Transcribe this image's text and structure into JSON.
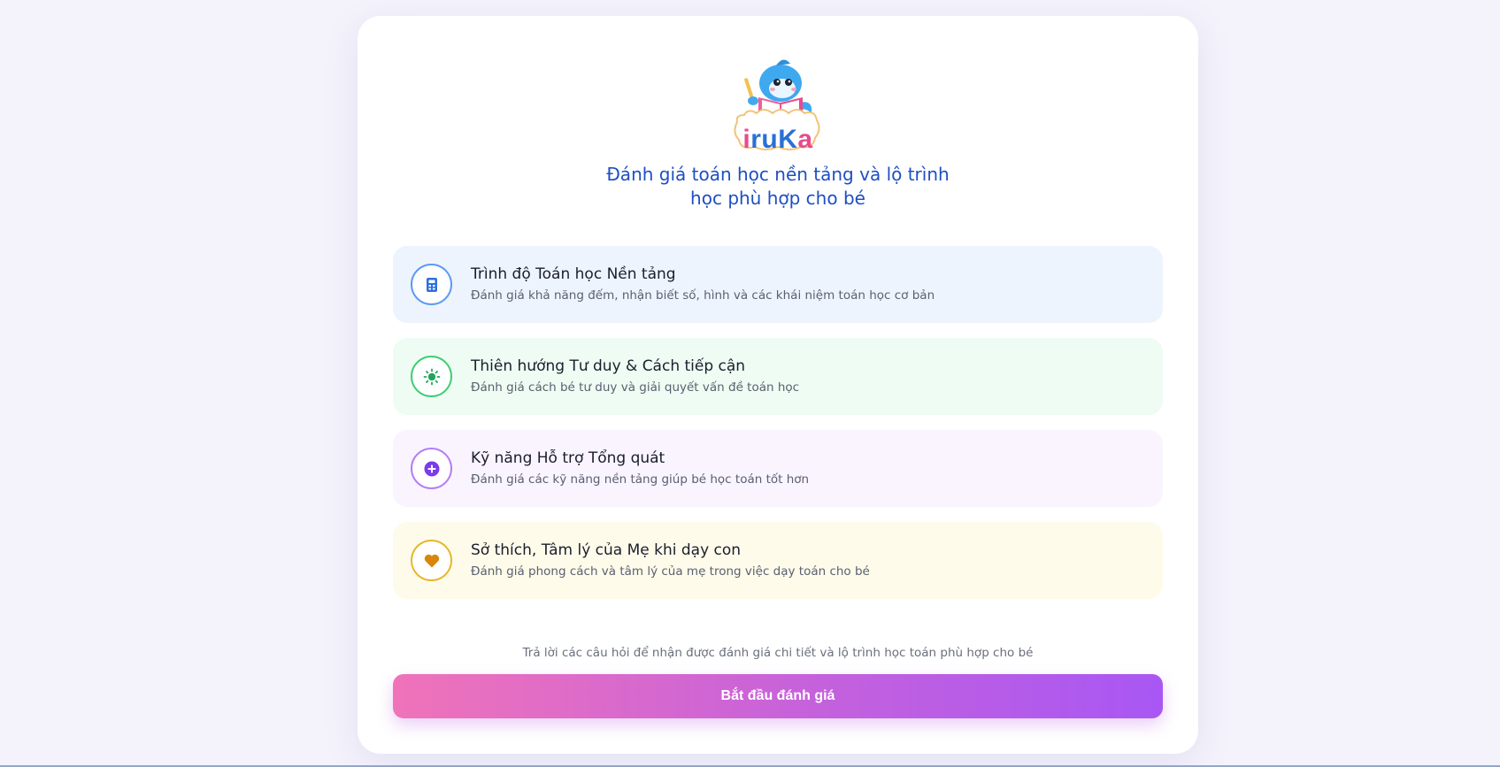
{
  "logo": {
    "text": "iruKa",
    "mascot": "dolphin-reading-book"
  },
  "headline": {
    "line1": "Đánh giá toán học nền tảng và lộ trình",
    "line2": "học phù hợp cho bé"
  },
  "features": [
    {
      "icon": "calculator-icon",
      "color": "#2f6fe0",
      "title": "Trình độ Toán học Nền tảng",
      "description": "Đánh giá khả năng đếm, nhận biết số, hình và các khái niệm toán học cơ bản"
    },
    {
      "icon": "sun-icon",
      "color": "#22a55b",
      "title": "Thiên hướng Tư duy & Cách tiếp cận",
      "description": "Đánh giá cách bé tư duy và giải quyết vấn đề toán học"
    },
    {
      "icon": "plus-circle-icon",
      "color": "#7c3aed",
      "title": "Kỹ năng Hỗ trợ Tổng quát",
      "description": "Đánh giá các kỹ năng nền tảng giúp bé học toán tốt hơn"
    },
    {
      "icon": "heart-icon",
      "color": "#d9860d",
      "title": "Sở thích, Tâm lý của Mẹ khi dạy con",
      "description": "Đánh giá phong cách và tâm lý của mẹ trong việc dạy toán cho bé"
    }
  ],
  "hint": "Trả lời các câu hỏi để nhận được đánh giá chi tiết và lộ trình học toán phù hợp cho bé",
  "cta": {
    "label": "Bắt đầu đánh giá"
  }
}
